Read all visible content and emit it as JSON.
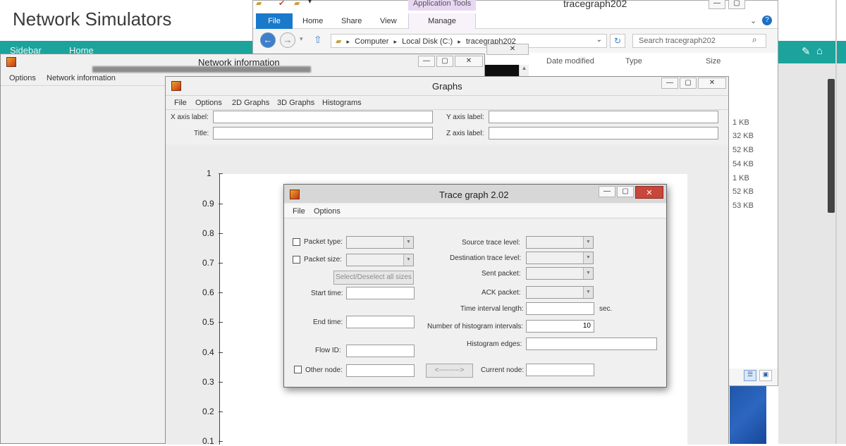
{
  "blog": {
    "title": "Network Simulators",
    "nav_sidebar": "Sidebar",
    "nav_home": "Home",
    "edit_icon": "pencil-icon",
    "home_icon": "home-icon"
  },
  "explorer": {
    "title": "tracegraph202",
    "app_tools": "Application Tools",
    "tabs": {
      "file": "File",
      "home": "Home",
      "share": "Share",
      "view": "View",
      "manage": "Manage"
    },
    "breadcrumb": {
      "sep": "▸",
      "computer": "Computer",
      "disk": "Local Disk (C:)",
      "folder": "tracegraph202"
    },
    "search_placeholder": "Search tracegraph202",
    "columns": {
      "date": "Date modified",
      "type": "Type",
      "size": "Size"
    },
    "sizes": [
      "1 KB",
      "32 KB",
      "52 KB",
      "54 KB",
      "1 KB",
      "52 KB",
      "53 KB"
    ]
  },
  "netinfo": {
    "title": "Network information",
    "menu": {
      "options": "Options",
      "network_information": "Network information"
    }
  },
  "graphs": {
    "title": "Graphs",
    "menu": {
      "file": "File",
      "options": "Options",
      "graphs2d": "2D Graphs",
      "graphs3d": "3D Graphs",
      "histograms": "Histograms"
    },
    "labels": {
      "x_axis": "X axis label:",
      "title": "Title:",
      "y_axis": "Y axis label:",
      "z_axis": "Z axis label:"
    },
    "y_ticks": [
      "1",
      "0.9",
      "0.8",
      "0.7",
      "0.6",
      "0.5",
      "0.4",
      "0.3",
      "0.2",
      "0.1"
    ]
  },
  "dialog": {
    "title": "Trace graph 2.02",
    "menu": {
      "file": "File",
      "options": "Options"
    },
    "left": {
      "packet_type": "Packet type:",
      "packet_size": "Packet size:",
      "select_all": "Select/Deselect all sizes",
      "start_time": "Start time:",
      "end_time": "End time:",
      "flow_id": "Flow ID:",
      "other_node": "Other node:"
    },
    "right": {
      "source_trace": "Source trace level:",
      "dest_trace": "Destination trace level:",
      "sent_packet": "Sent packet:",
      "ack_packet": "ACK packet:",
      "time_interval": "Time interval length:",
      "sec": "sec.",
      "num_hist": "Number of histogram intervals:",
      "num_hist_value": "10",
      "hist_edges": "Histogram edges:",
      "current_node": "Current node:"
    },
    "nav_button": "<--------->"
  }
}
